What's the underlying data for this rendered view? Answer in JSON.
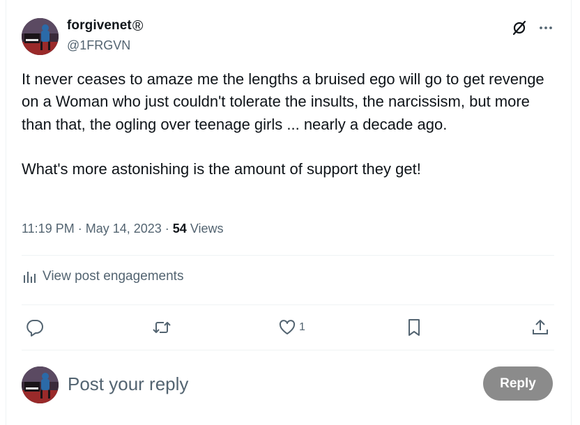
{
  "author": {
    "display_name": "forgivenet",
    "verified_mark": "®",
    "handle": "@1FRGVN",
    "avatar_icon": "piano-player-avatar"
  },
  "header_icons": [
    "grok-icon",
    "more-icon"
  ],
  "post": {
    "text": "It never ceases to amaze me the lengths a bruised ego will go to get revenge on a Woman who just couldn't tolerate the insults, the narcissism, but more than that, the ogling over teenage girls ... nearly a decade ago.\n\nWhat's more astonishing is the amount of support they get!",
    "time": "11:19 PM",
    "separator": " · ",
    "date": "May 14, 2023",
    "views_count": "54",
    "views_label": " Views"
  },
  "engagements": {
    "label": "View post engagements",
    "icon": "bar-chart-icon"
  },
  "actions": {
    "reply_icon": "reply-icon",
    "repost_icon": "repost-icon",
    "like_icon": "like-icon",
    "like_count": "1",
    "bookmark_icon": "bookmark-icon",
    "share_icon": "share-icon"
  },
  "reply_box": {
    "placeholder": "Post your reply",
    "button_label": "Reply"
  },
  "colors": {
    "text_primary": "#0f1419",
    "text_secondary": "#536471",
    "divider": "#eff3f4",
    "reply_button_disabled": "#8b8b8b"
  }
}
